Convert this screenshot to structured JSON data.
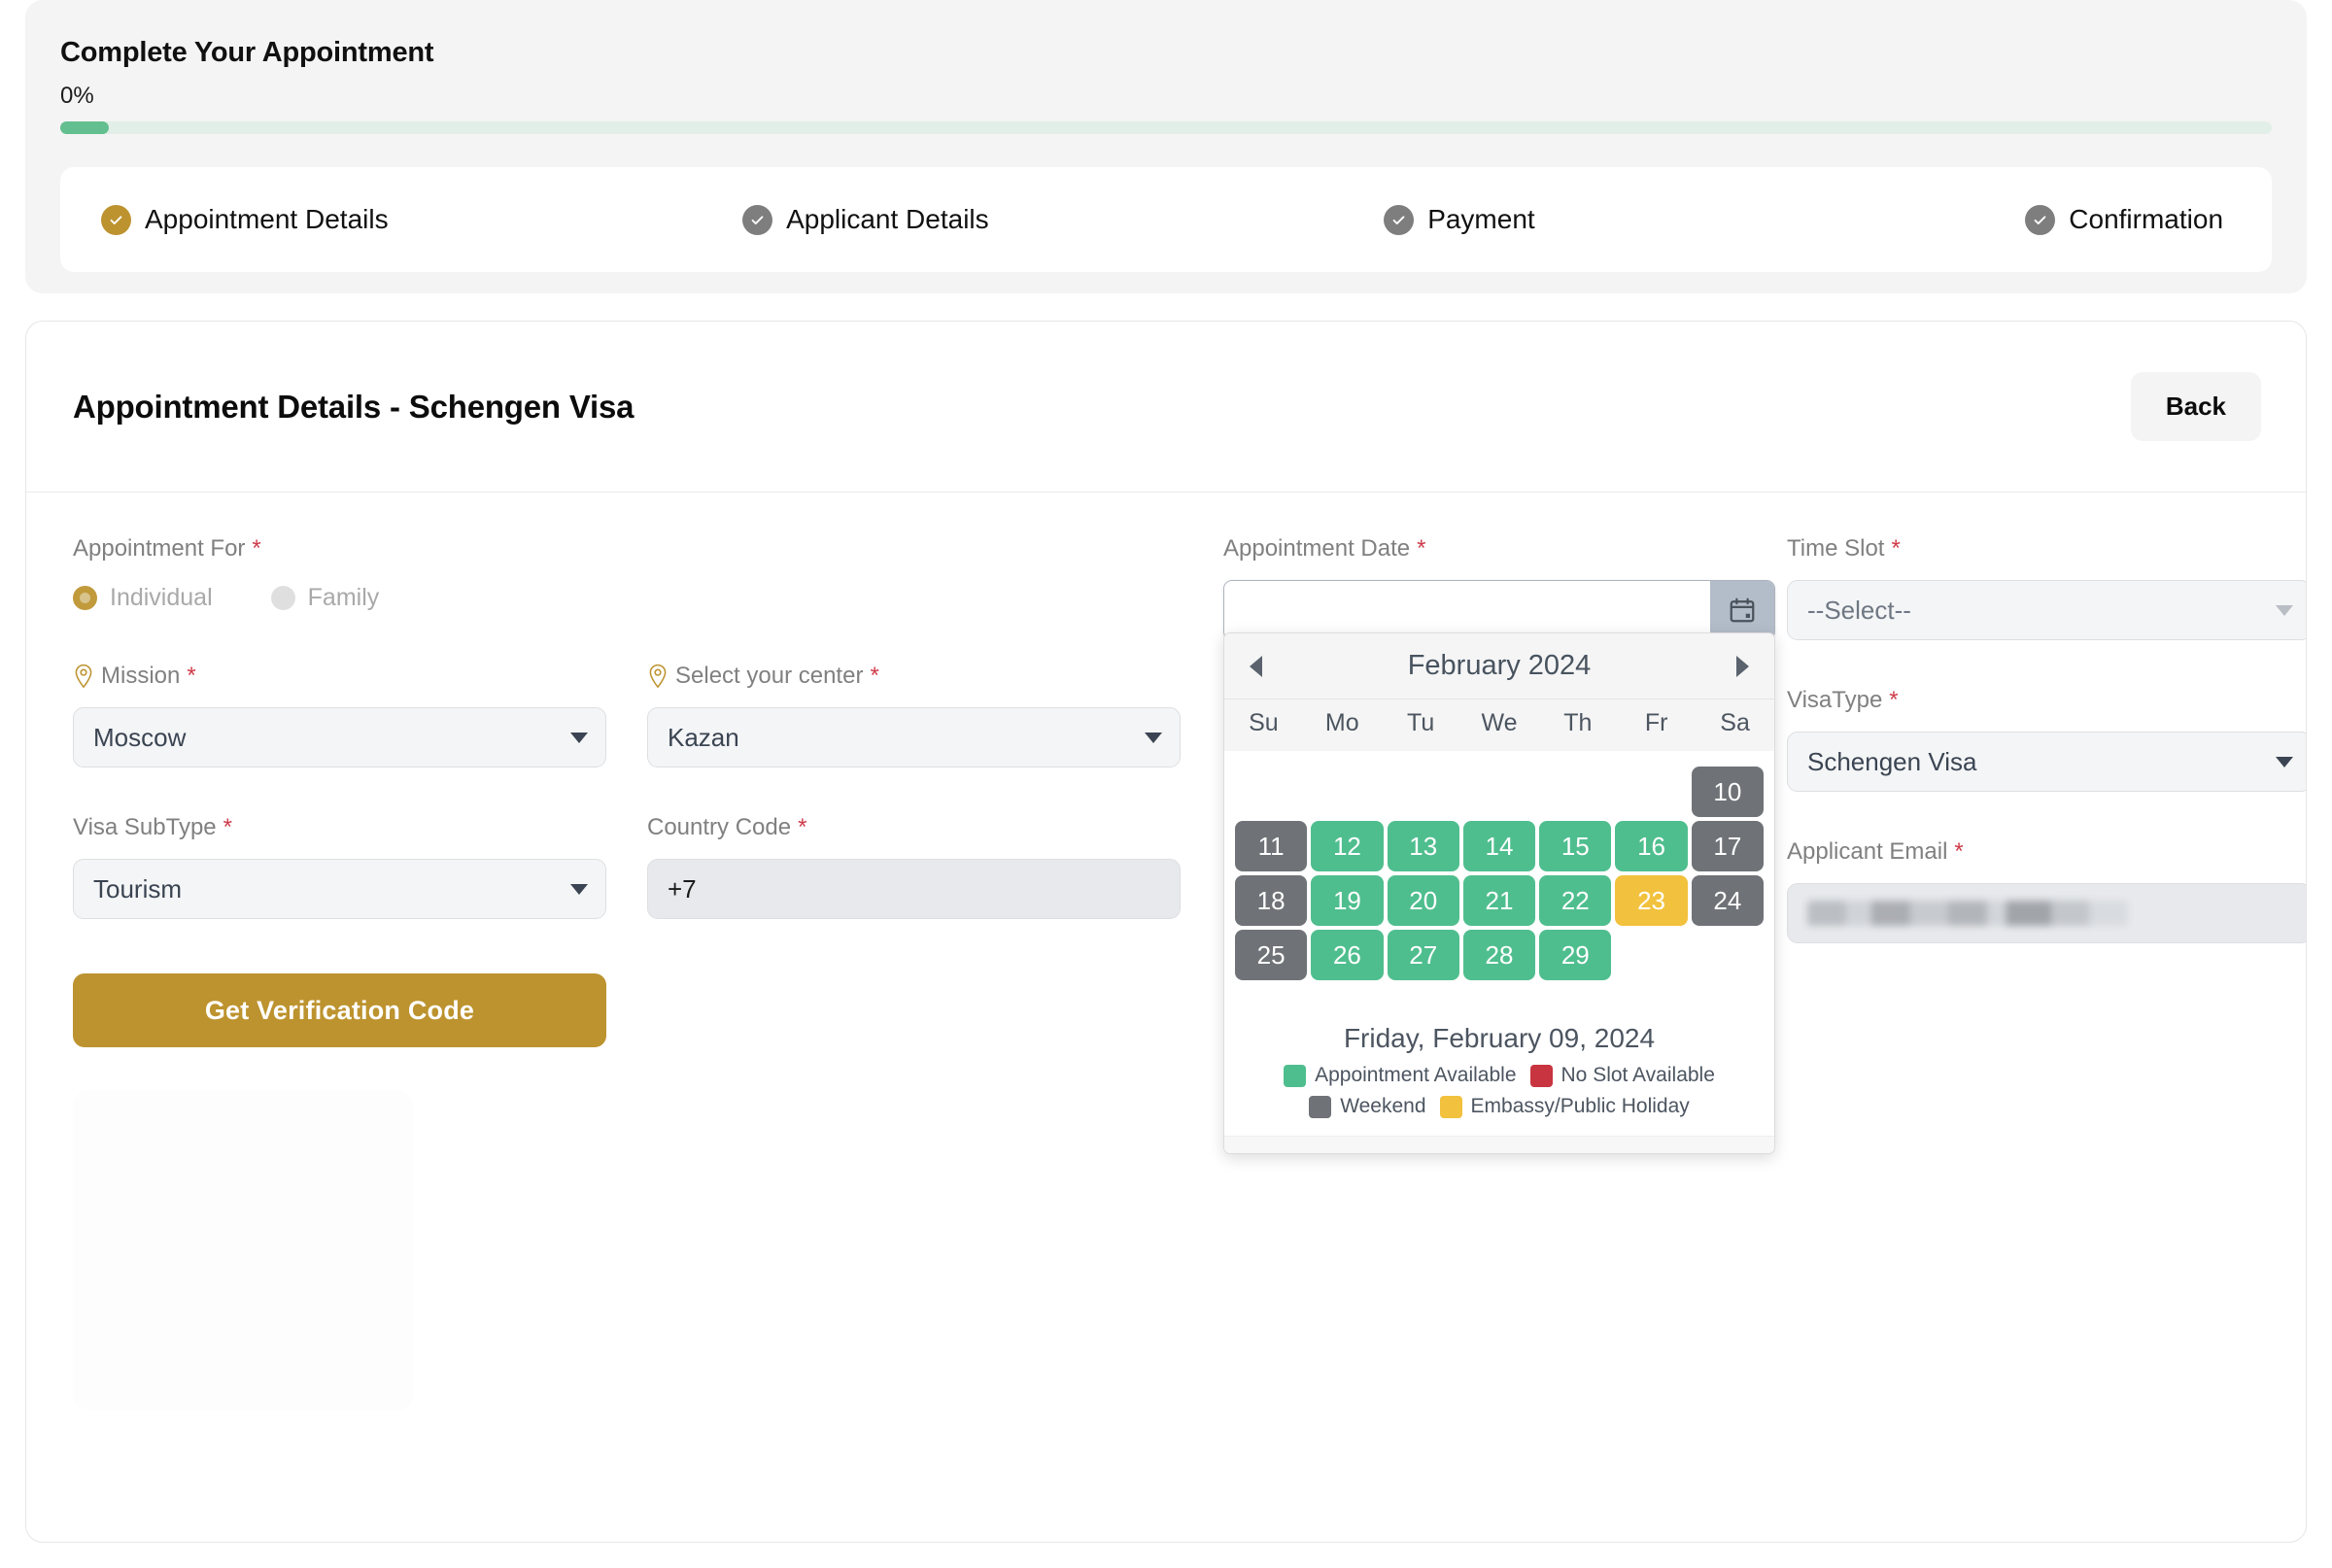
{
  "progress": {
    "title": "Complete Your Appointment",
    "percent_label": "0%",
    "percent_value": 0
  },
  "steps": [
    {
      "label": "Appointment Details",
      "state": "active",
      "color": "#bd932f",
      "icon": "check-circle-icon"
    },
    {
      "label": "Applicant Details",
      "state": "inactive",
      "color": "#7e7e7e",
      "icon": "check-circle-icon"
    },
    {
      "label": "Payment",
      "state": "inactive",
      "color": "#7e7e7e",
      "icon": "check-circle-icon"
    },
    {
      "label": "Confirmation",
      "state": "inactive",
      "color": "#7e7e7e",
      "icon": "check-circle-icon"
    }
  ],
  "card": {
    "title": "Appointment Details - Schengen Visa",
    "back_label": "Back"
  },
  "form": {
    "appointment_for": {
      "label": "Appointment For",
      "required": "*",
      "options": [
        {
          "label": "Individual",
          "selected": true
        },
        {
          "label": "Family",
          "selected": false
        }
      ]
    },
    "mission": {
      "label": "Mission",
      "required": "*",
      "value": "Moscow",
      "icon": "map-pin-icon"
    },
    "center": {
      "label": "Select your center",
      "required": "*",
      "value": "Kazan",
      "icon": "map-pin-icon"
    },
    "visa_subtype": {
      "label": "Visa SubType",
      "required": "*",
      "value": "Tourism"
    },
    "country_code": {
      "label": "Country Code",
      "required": "*",
      "value": "+7",
      "disabled": true
    },
    "verify_button": "Get Verification Code",
    "appointment_date": {
      "label": "Appointment Date",
      "required": "*",
      "value": "",
      "placeholder": ""
    },
    "time_slot": {
      "label": "Time Slot",
      "required": "*",
      "value": "--Select--"
    },
    "visa_type": {
      "label": "VisaType",
      "required": "*",
      "value": "Schengen Visa"
    },
    "applicant_email": {
      "label": "Applicant Email",
      "required": "*",
      "value": "",
      "redacted": true
    }
  },
  "calendar": {
    "month_title": "February 2024",
    "prev_icon": "chevron-left-icon",
    "next_icon": "chevron-right-icon",
    "calendar_icon": "calendar-icon",
    "day_headers": [
      "Su",
      "Mo",
      "Tu",
      "We",
      "Th",
      "Fr",
      "Sa"
    ],
    "selected_date_label": "Friday, February 09, 2024",
    "weeks": [
      [
        {
          "day": "",
          "state": "empty"
        },
        {
          "day": "",
          "state": "empty"
        },
        {
          "day": "",
          "state": "empty"
        },
        {
          "day": "",
          "state": "empty"
        },
        {
          "day": "",
          "state": "empty"
        },
        {
          "day": "",
          "state": "empty"
        },
        {
          "day": "10",
          "state": "weekend"
        }
      ],
      [
        {
          "day": "11",
          "state": "weekend"
        },
        {
          "day": "12",
          "state": "avail"
        },
        {
          "day": "13",
          "state": "avail"
        },
        {
          "day": "14",
          "state": "avail"
        },
        {
          "day": "15",
          "state": "avail"
        },
        {
          "day": "16",
          "state": "avail"
        },
        {
          "day": "17",
          "state": "weekend"
        }
      ],
      [
        {
          "day": "18",
          "state": "weekend"
        },
        {
          "day": "19",
          "state": "avail"
        },
        {
          "day": "20",
          "state": "avail"
        },
        {
          "day": "21",
          "state": "avail"
        },
        {
          "day": "22",
          "state": "avail"
        },
        {
          "day": "23",
          "state": "holiday"
        },
        {
          "day": "24",
          "state": "weekend"
        }
      ],
      [
        {
          "day": "25",
          "state": "weekend"
        },
        {
          "day": "26",
          "state": "avail"
        },
        {
          "day": "27",
          "state": "avail"
        },
        {
          "day": "28",
          "state": "avail"
        },
        {
          "day": "29",
          "state": "avail"
        },
        {
          "day": "",
          "state": "empty"
        },
        {
          "day": "",
          "state": "empty"
        }
      ]
    ],
    "legend": [
      {
        "label": "Appointment Available",
        "color": "#4fbe8e"
      },
      {
        "label": "No Slot Available",
        "color": "#c8343f"
      },
      {
        "label": "Weekend",
        "color": "#6f7276"
      },
      {
        "label": "Embassy/Public Holiday",
        "color": "#f2c13d"
      }
    ]
  },
  "theme": {
    "accent_gold": "#bd932f",
    "progress_green": "#63bf90",
    "required_red": "#cf3b4a"
  }
}
